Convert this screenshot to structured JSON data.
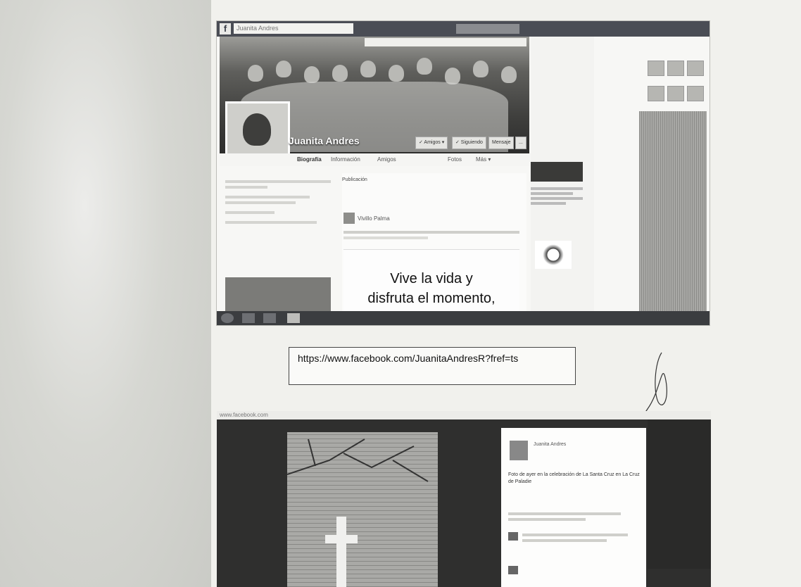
{
  "screenshot1": {
    "search_text": "Juanita Andres",
    "profile_name": "Juanita Andres",
    "cover_buttons": [
      "✓ Amigos ▾",
      "✓ Siguiendo",
      "Mensaje",
      "..."
    ],
    "nav_tabs": [
      "Biografía",
      "Información",
      "Amigos",
      "Fotos",
      "Más ▾"
    ],
    "post_header": "Publicación",
    "post_author": "Vivillo Palma",
    "quote_line1": "Vive la vida y",
    "quote_line2": "disfruta el momento,"
  },
  "url_box": {
    "url": "https://www.facebook.com/JuanitaAndresR?fref=ts"
  },
  "screenshot2": {
    "url_strip": "www.facebook.com",
    "panel_name": "Juanita Andres",
    "caption": "Foto de ayer en la celebración de La Santa Cruz en La Cruz de Paladie"
  }
}
